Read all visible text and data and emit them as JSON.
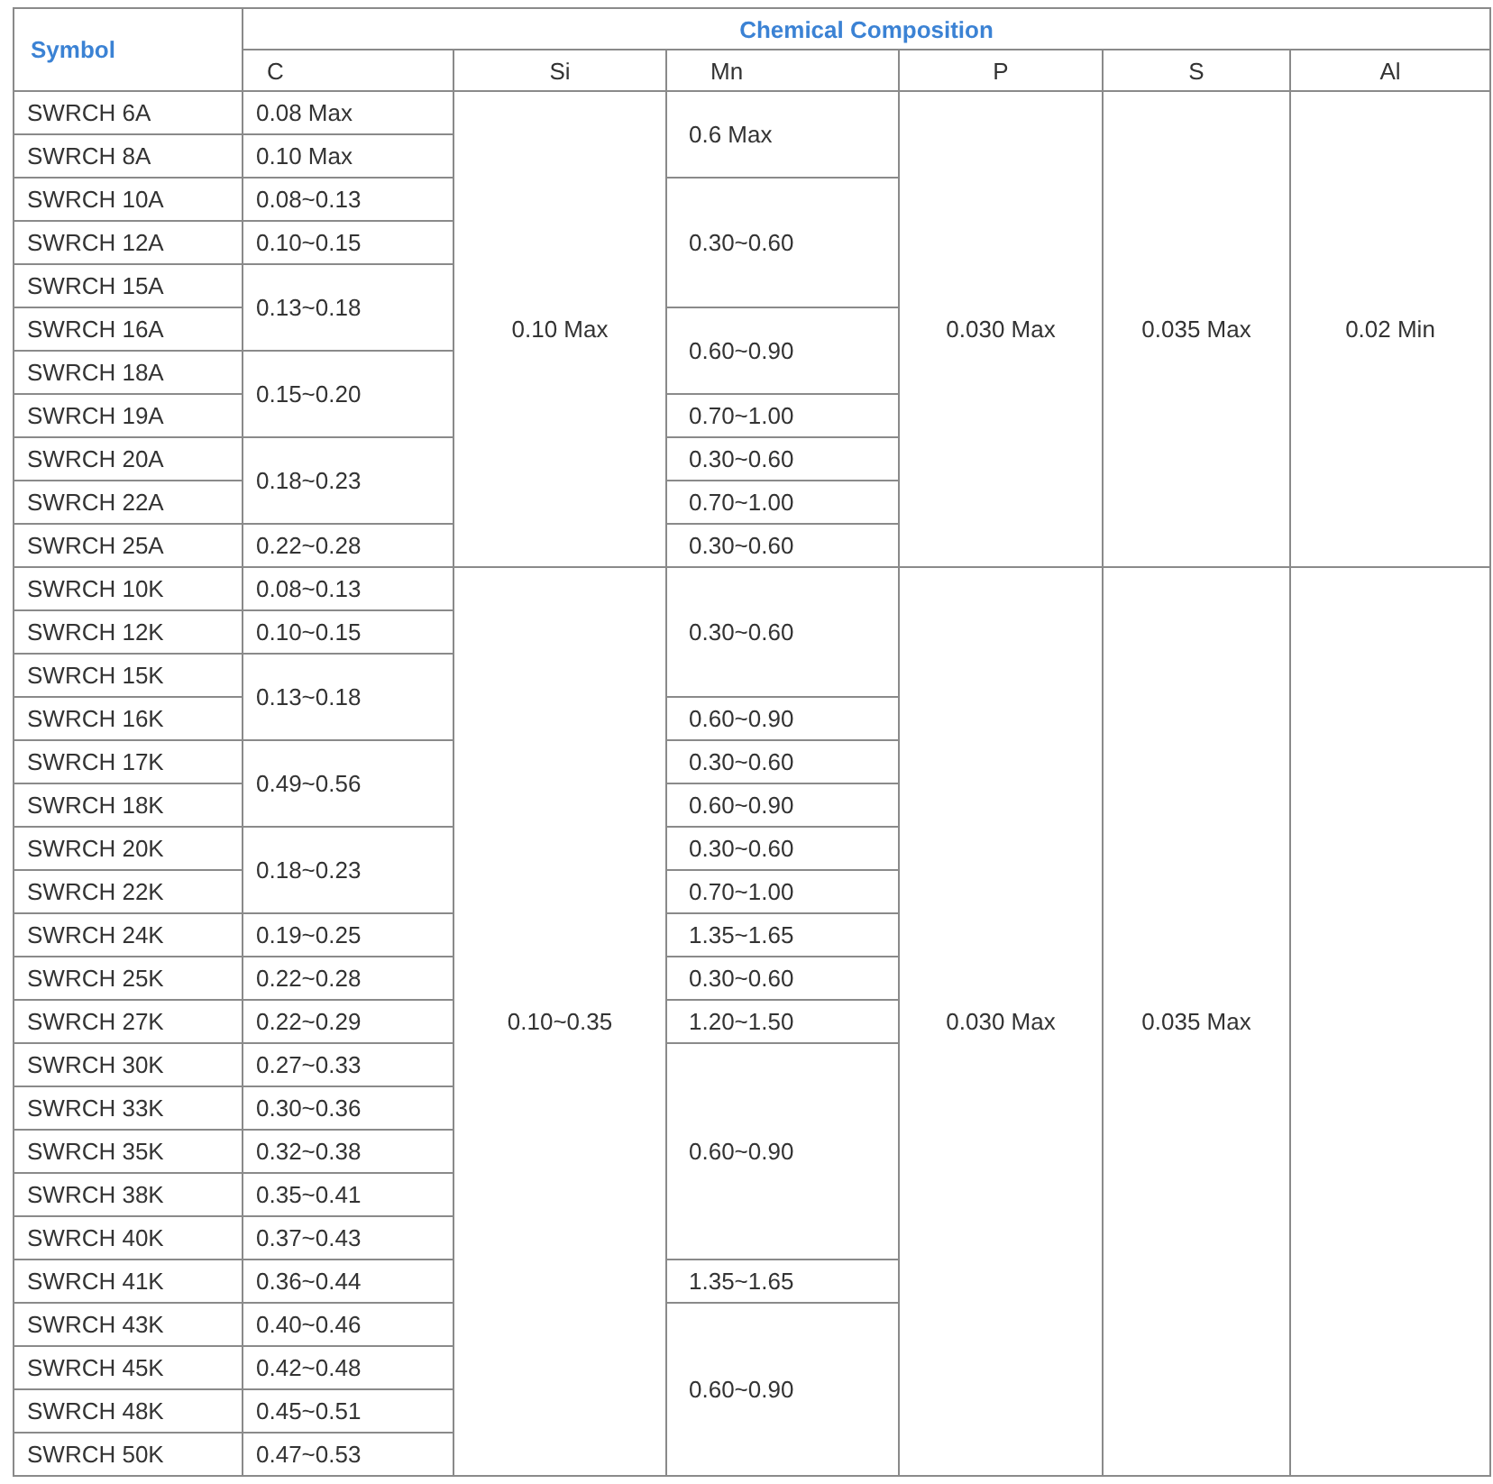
{
  "table": {
    "header_rows": [
      {
        "cells": [
          {
            "text": "Symbol",
            "rowspan": 2
          },
          {
            "text": "Chemical Composition",
            "colspan": 6
          }
        ]
      },
      {
        "cells": [
          {
            "text": "C"
          },
          {
            "text": "Si"
          },
          {
            "text": "Mn"
          },
          {
            "text": "P"
          },
          {
            "text": "S"
          },
          {
            "text": "Al"
          }
        ]
      }
    ],
    "rows": [
      {
        "cells": [
          {
            "text": "SWRCH 6A"
          },
          {
            "text": "0.08 Max"
          },
          {
            "text": "0.10 Max",
            "rowspan": 11
          },
          {
            "text": "0.6 Max",
            "rowspan": 2
          },
          {
            "text": "0.030 Max",
            "rowspan": 11
          },
          {
            "text": "0.035 Max",
            "rowspan": 11
          },
          {
            "text": "0.02 Min",
            "rowspan": 11
          }
        ]
      },
      {
        "cells": [
          {
            "text": "SWRCH 8A"
          },
          {
            "text": "0.10 Max"
          }
        ]
      },
      {
        "cells": [
          {
            "text": "SWRCH 10A"
          },
          {
            "text": "0.08~0.13"
          },
          {
            "text": "0.30~0.60",
            "rowspan": 3
          }
        ]
      },
      {
        "cells": [
          {
            "text": "SWRCH 12A"
          },
          {
            "text": "0.10~0.15"
          }
        ]
      },
      {
        "cells": [
          {
            "text": "SWRCH 15A"
          },
          {
            "text": "0.13~0.18",
            "rowspan": 2
          }
        ]
      },
      {
        "cells": [
          {
            "text": "SWRCH 16A"
          },
          {
            "text": "0.60~0.90",
            "rowspan": 2
          }
        ]
      },
      {
        "cells": [
          {
            "text": "SWRCH 18A"
          },
          {
            "text": "0.15~0.20",
            "rowspan": 2
          }
        ]
      },
      {
        "cells": [
          {
            "text": "SWRCH 19A"
          },
          {
            "text": "0.70~1.00"
          }
        ]
      },
      {
        "cells": [
          {
            "text": "SWRCH 20A"
          },
          {
            "text": "0.18~0.23",
            "rowspan": 2
          },
          {
            "text": "0.30~0.60"
          }
        ]
      },
      {
        "cells": [
          {
            "text": "SWRCH 22A"
          },
          {
            "text": "0.70~1.00"
          }
        ]
      },
      {
        "cells": [
          {
            "text": "SWRCH 25A"
          },
          {
            "text": "0.22~0.28"
          },
          {
            "text": "0.30~0.60"
          }
        ]
      },
      {
        "cells": [
          {
            "text": "SWRCH 10K"
          },
          {
            "text": "0.08~0.13"
          },
          {
            "text": "0.10~0.35",
            "rowspan": 21
          },
          {
            "text": "0.30~0.60",
            "rowspan": 3
          },
          {
            "text": "0.030 Max",
            "rowspan": 21
          },
          {
            "text": "0.035 Max",
            "rowspan": 21
          },
          {
            "rowspan": 21
          }
        ]
      },
      {
        "cells": [
          {
            "text": "SWRCH 12K"
          },
          {
            "text": "0.10~0.15"
          }
        ]
      },
      {
        "cells": [
          {
            "text": "SWRCH 15K"
          },
          {
            "text": "0.13~0.18",
            "rowspan": 2
          }
        ]
      },
      {
        "cells": [
          {
            "text": "SWRCH 16K"
          },
          {
            "text": "0.60~0.90"
          }
        ]
      },
      {
        "cells": [
          {
            "text": "SWRCH 17K"
          },
          {
            "text": "0.49~0.56",
            "rowspan": 2
          },
          {
            "text": "0.30~0.60"
          }
        ]
      },
      {
        "cells": [
          {
            "text": "SWRCH 18K"
          },
          {
            "text": "0.60~0.90"
          }
        ]
      },
      {
        "cells": [
          {
            "text": "SWRCH 20K"
          },
          {
            "text": "0.18~0.23",
            "rowspan": 2
          },
          {
            "text": "0.30~0.60"
          }
        ]
      },
      {
        "cells": [
          {
            "text": "SWRCH 22K"
          },
          {
            "text": "0.70~1.00"
          }
        ]
      },
      {
        "cells": [
          {
            "text": "SWRCH 24K"
          },
          {
            "text": "0.19~0.25"
          },
          {
            "text": "1.35~1.65"
          }
        ]
      },
      {
        "cells": [
          {
            "text": "SWRCH 25K"
          },
          {
            "text": "0.22~0.28"
          },
          {
            "text": "0.30~0.60"
          }
        ]
      },
      {
        "cells": [
          {
            "text": "SWRCH 27K"
          },
          {
            "text": "0.22~0.29"
          },
          {
            "text": "1.20~1.50"
          }
        ]
      },
      {
        "cells": [
          {
            "text": "SWRCH 30K"
          },
          {
            "text": "0.27~0.33"
          },
          {
            "text": "0.60~0.90",
            "rowspan": 5
          }
        ]
      },
      {
        "cells": [
          {
            "text": "SWRCH 33K"
          },
          {
            "text": "0.30~0.36"
          }
        ]
      },
      {
        "cells": [
          {
            "text": "SWRCH 35K"
          },
          {
            "text": "0.32~0.38"
          }
        ]
      },
      {
        "cells": [
          {
            "text": "SWRCH 38K"
          },
          {
            "text": "0.35~0.41"
          }
        ]
      },
      {
        "cells": [
          {
            "text": "SWRCH 40K"
          },
          {
            "text": "0.37~0.43"
          }
        ]
      },
      {
        "cells": [
          {
            "text": "SWRCH 41K"
          },
          {
            "text": "0.36~0.44"
          },
          {
            "text": "1.35~1.65"
          }
        ]
      },
      {
        "cells": [
          {
            "text": "SWRCH 43K"
          },
          {
            "text": "0.40~0.46"
          },
          {
            "text": "0.60~0.90",
            "rowspan": 4
          }
        ]
      },
      {
        "cells": [
          {
            "text": "SWRCH 45K"
          },
          {
            "text": "0.42~0.48"
          }
        ]
      },
      {
        "cells": [
          {
            "text": "SWRCH 48K"
          },
          {
            "text": "0.45~0.51"
          }
        ]
      },
      {
        "cells": [
          {
            "text": "SWRCH 50K"
          },
          {
            "text": "0.47~0.53"
          }
        ]
      }
    ]
  }
}
